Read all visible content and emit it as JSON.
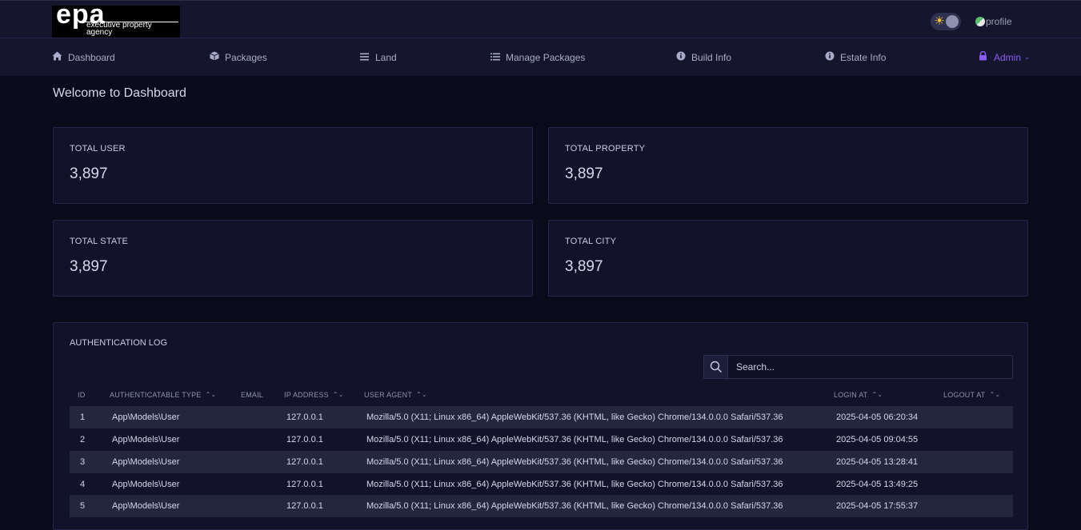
{
  "brand": {
    "logo_main": "epa",
    "logo_sub": "executive property agency"
  },
  "header": {
    "profile_alt": "profile"
  },
  "nav": [
    {
      "label": "Dashboard",
      "icon": "home-icon"
    },
    {
      "label": "Packages",
      "icon": "box-icon"
    },
    {
      "label": "Land",
      "icon": "menu-icon"
    },
    {
      "label": "Manage Packages",
      "icon": "list-icon"
    },
    {
      "label": "Build Info",
      "icon": "info-icon"
    },
    {
      "label": "Estate Info",
      "icon": "info-icon"
    },
    {
      "label": "Admin",
      "icon": "lock-icon"
    }
  ],
  "page": {
    "title": "Welcome to Dashboard"
  },
  "stats": [
    {
      "label": "TOTAL USER",
      "value": "3,897"
    },
    {
      "label": "TOTAL PROPERTY",
      "value": "3,897"
    },
    {
      "label": "TOTAL STATE",
      "value": "3,897"
    },
    {
      "label": "TOTAL CITY",
      "value": "3,897"
    }
  ],
  "auth_log": {
    "title": "AUTHENTICATION LOG",
    "search_placeholder": "Search...",
    "columns": [
      "ID",
      "AUTHENTICATABLE TYPE",
      "EMAIL",
      "IP ADDRESS",
      "USER AGENT",
      "LOGIN AT",
      "LOGOUT AT"
    ],
    "rows": [
      {
        "id": "1",
        "type": "App\\Models\\User",
        "email": "",
        "ip": "127.0.0.1",
        "agent": "Mozilla/5.0 (X11; Linux x86_64) AppleWebKit/537.36 (KHTML, like Gecko) Chrome/134.0.0.0 Safari/537.36",
        "login": "2025-04-05 06:20:34",
        "logout": ""
      },
      {
        "id": "2",
        "type": "App\\Models\\User",
        "email": "",
        "ip": "127.0.0.1",
        "agent": "Mozilla/5.0 (X11; Linux x86_64) AppleWebKit/537.36 (KHTML, like Gecko) Chrome/134.0.0.0 Safari/537.36",
        "login": "2025-04-05 09:04:55",
        "logout": ""
      },
      {
        "id": "3",
        "type": "App\\Models\\User",
        "email": "",
        "ip": "127.0.0.1",
        "agent": "Mozilla/5.0 (X11; Linux x86_64) AppleWebKit/537.36 (KHTML, like Gecko) Chrome/134.0.0.0 Safari/537.36",
        "login": "2025-04-05 13:28:41",
        "logout": ""
      },
      {
        "id": "4",
        "type": "App\\Models\\User",
        "email": "",
        "ip": "127.0.0.1",
        "agent": "Mozilla/5.0 (X11; Linux x86_64) AppleWebKit/537.36 (KHTML, like Gecko) Chrome/134.0.0.0 Safari/537.36",
        "login": "2025-04-05 13:49:25",
        "logout": ""
      },
      {
        "id": "5",
        "type": "App\\Models\\User",
        "email": "",
        "ip": "127.0.0.1",
        "agent": "Mozilla/5.0 (X11; Linux x86_64) AppleWebKit/537.36 (KHTML, like Gecko) Chrome/134.0.0.0 Safari/537.36",
        "login": "2025-04-05 17:55:37",
        "logout": ""
      }
    ]
  },
  "colors": {
    "background": "#0a0b1a",
    "nav_bg": "#15162e",
    "card_bg": "#12132a",
    "accent": "#8a5cf6",
    "row_stripe": "#24263f"
  }
}
